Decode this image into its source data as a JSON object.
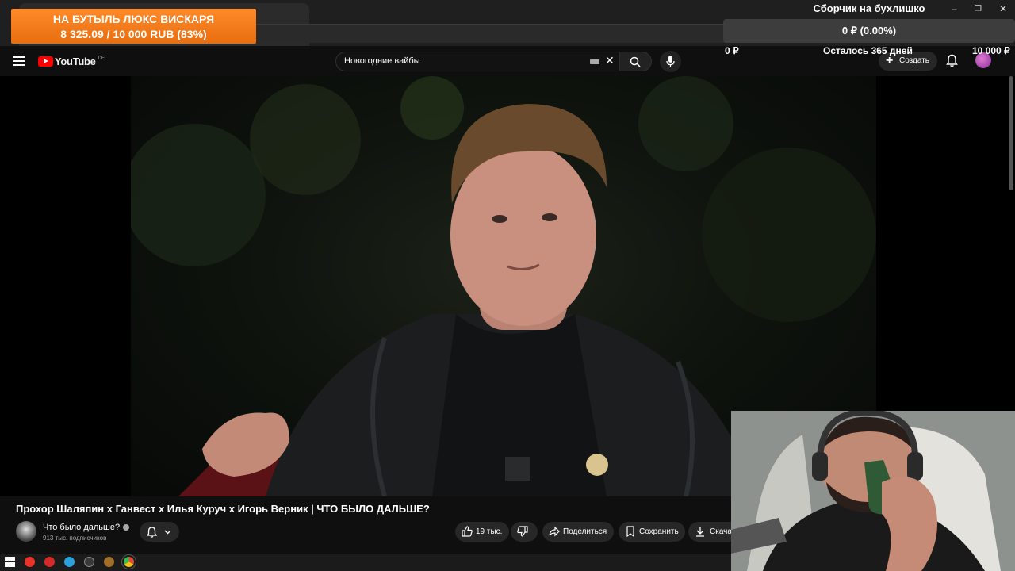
{
  "donation_overlay": {
    "line1": "НА БУТЫЛЬ ЛЮКС ВИСКАРЯ",
    "line2": "8 325.09 / 10 000 RUB (83%)",
    "progress_percent": 83
  },
  "fundraiser": {
    "title": "Сборчик на бухлишко",
    "progress": "0 ₽ (0.00%)",
    "min": "0 ₽",
    "remaining": "Осталось 365 дней",
    "max": "10 000 ₽",
    "window_controls": [
      "–",
      "❐",
      "✕"
    ]
  },
  "header": {
    "logo_text": "YouTube",
    "region": "DE",
    "search_value": "Новогодние вайбы",
    "create_label": "Создать"
  },
  "video": {
    "title": "Прохор Шаляпин x Ганвест x Илья Куруч x Игорь Верник | ЧТО БЫЛО ДАЛЬШЕ?",
    "channel": "Что было дальше?",
    "subscribers": "913 тыс. подписчиков",
    "likes": "19 тыс.",
    "share_label": "Поделиться",
    "save_label": "Сохранить",
    "download_label": "Скачать"
  },
  "taskbar": {
    "icons": [
      "windows-start-icon",
      "yandex-browser-icon",
      "yandex-icon",
      "telegram-icon",
      "obs-icon",
      "app-icon",
      "chrome-icon"
    ],
    "colors": [
      "#2b8ae6",
      "#e8332b",
      "#d62a2a",
      "#2aa1da",
      "#8d8d8d",
      "#a0702a",
      "#dd4b39"
    ]
  }
}
